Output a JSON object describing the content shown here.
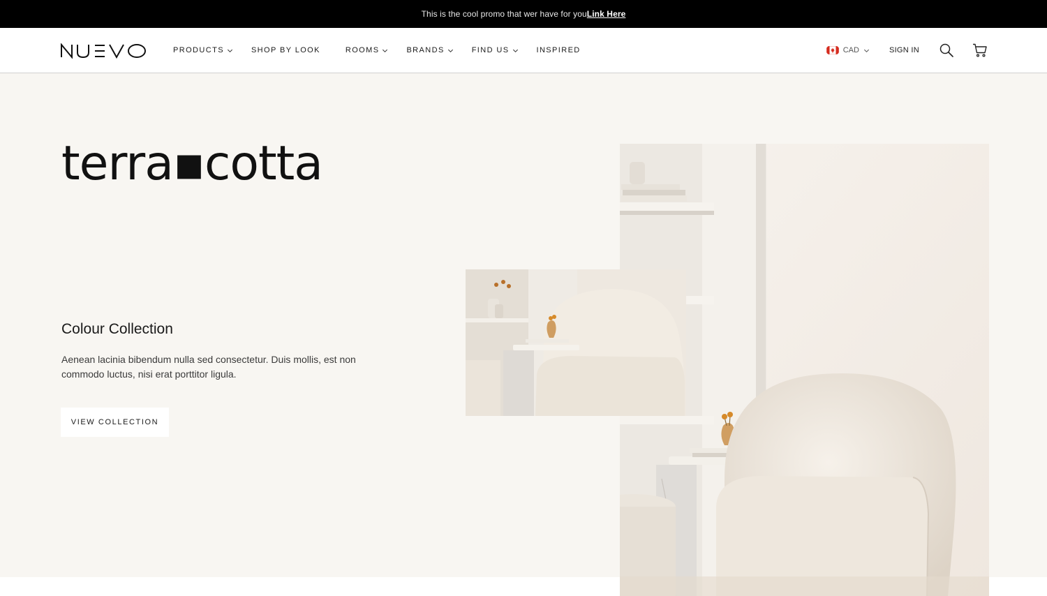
{
  "promo": {
    "text": "This is the cool promo that wer have for you",
    "link_label": "Link Here"
  },
  "header": {
    "logo_text": "NUEVO",
    "nav": [
      {
        "label": "PRODUCTS",
        "has_dropdown": true
      },
      {
        "label": "SHOP BY LOOK",
        "has_dropdown": false
      },
      {
        "label": "ROOMS",
        "has_dropdown": true
      },
      {
        "label": "BRANDS",
        "has_dropdown": true
      },
      {
        "label": "FIND US",
        "has_dropdown": true
      },
      {
        "label": "INSPIRED",
        "has_dropdown": false
      }
    ],
    "currency": "CAD",
    "signin_label": "SIGN IN",
    "icons": {
      "search": "search-icon",
      "cart": "cart-icon",
      "flag": "canada-flag-icon",
      "chevron": "chevron-down-icon"
    }
  },
  "hero": {
    "brand_title": "terra▪cotta",
    "collection_heading": "Colour Collection",
    "collection_desc": "Aenean lacinia bibendum nulla sed consectetur. Duis mollis, est non commodo luctus, nisi erat porttitor ligula.",
    "cta_label": "VIEW COLLECTION",
    "background_color": "#f8f6f2"
  },
  "colors": {
    "promo_bg": "#000000",
    "text_primary": "#1a1a1a",
    "flag_red": "#d52b1e"
  }
}
